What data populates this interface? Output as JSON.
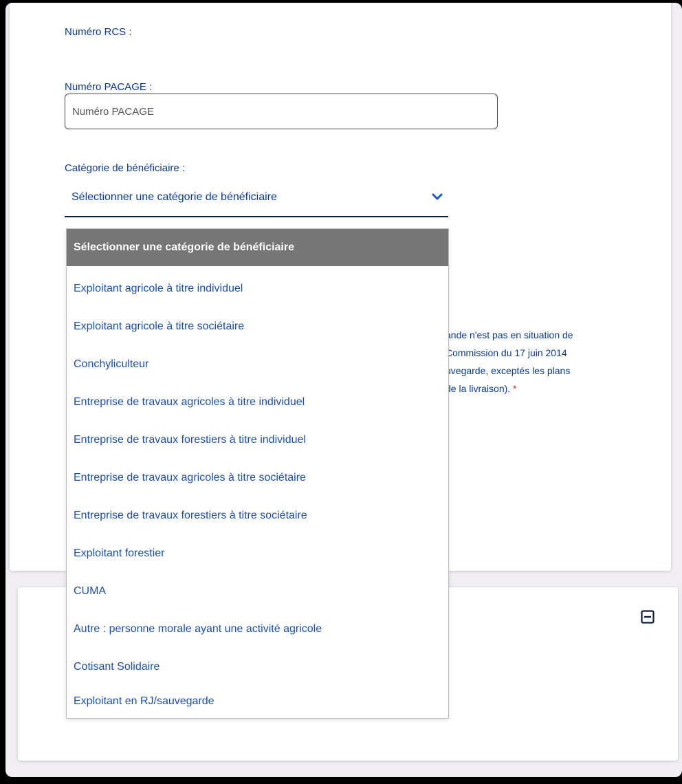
{
  "form": {
    "rcs_label": "Numéro RCS :",
    "pacage_label": "Numéro PACAGE :",
    "pacage_placeholder": "Numéro PACAGE",
    "pacage_value": "",
    "category_label": "Catégorie de bénéficiaire :",
    "category_selected": "Sélectionner une catégorie de bénéficiaire"
  },
  "dropdown": {
    "options": [
      "Sélectionner une catégorie de bénéficiaire",
      "Exploitant agricole à titre individuel",
      "Exploitant agricole à titre sociétaire",
      "Conchyliculteur",
      "Entreprise de travaux agricoles à titre individuel",
      "Entreprise de travaux forestiers à titre individuel",
      "Entreprise de travaux agricoles à titre sociétaire",
      "Entreprise de travaux forestiers à titre sociétaire",
      "Exploitant forestier",
      "CUMA",
      "Autre : personne morale ayant une activité agricole",
      "Cotisant Solidaire",
      "Exploitant en RJ/sauvegarde"
    ],
    "selected_index": 0
  },
  "hidden_text": {
    "line1": "ande n'est pas en situation de",
    "line2": "Commission du 17 juin 2014",
    "line3": "uvegarde, exceptés les plans",
    "line4": "de la livraison).",
    "required_mark": "*"
  },
  "colors": {
    "label": "#0a3a8f",
    "option_text": "#1c4fa6",
    "selected_bg": "#767676",
    "required": "#d0342c",
    "page_bg": "#f0eef3"
  },
  "icons": {
    "chevron": "chevron-down-icon",
    "collapse": "minus-square-icon"
  }
}
